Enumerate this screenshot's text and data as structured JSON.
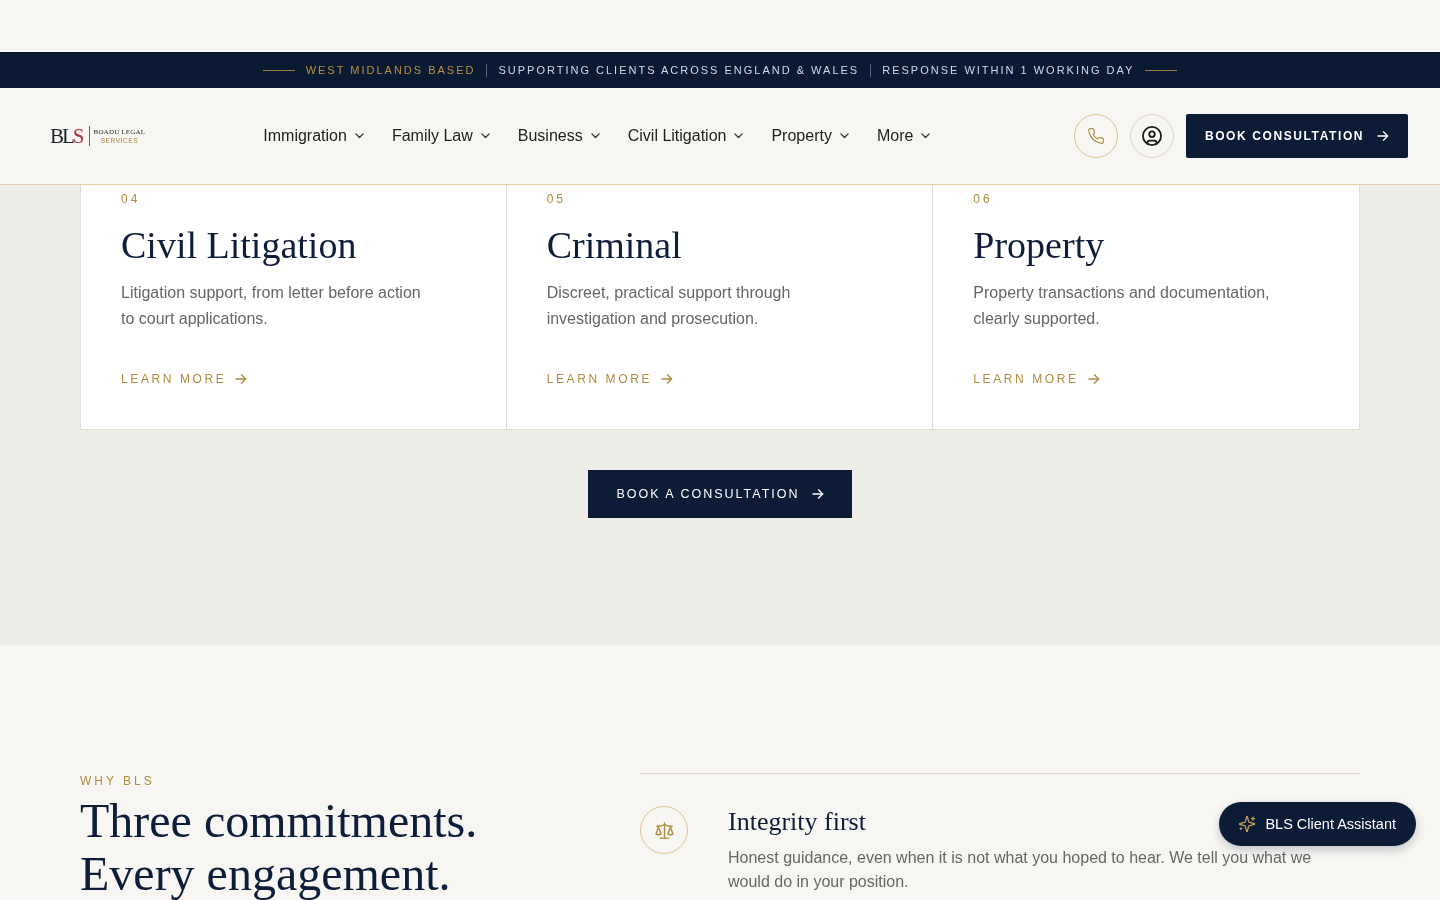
{
  "top_bar": {
    "items": [
      {
        "text": "WEST MIDLANDS BASED",
        "highlighted": true
      },
      {
        "text": "SUPPORTING CLIENTS ACROSS ENGLAND & WALES",
        "highlighted": false
      },
      {
        "text": "RESPONSE WITHIN 1 WORKING DAY",
        "highlighted": false
      }
    ]
  },
  "header": {
    "logo": {
      "monogram": "BLS",
      "name": "BOADU LEGAL",
      "tagline": "SERVICES"
    },
    "nav": [
      {
        "label": "Immigration"
      },
      {
        "label": "Family Law"
      },
      {
        "label": "Business"
      },
      {
        "label": "Civil Litigation"
      },
      {
        "label": "Property"
      },
      {
        "label": "More"
      }
    ],
    "cta": "BOOK CONSULTATION"
  },
  "services": {
    "cards": [
      {
        "number": "04",
        "title": "Civil Litigation",
        "description": "Litigation support, from letter before action to court applications.",
        "link": "LEARN MORE"
      },
      {
        "number": "05",
        "title": "Criminal",
        "description": "Discreet, practical support through investigation and prosecution.",
        "link": "LEARN MORE"
      },
      {
        "number": "06",
        "title": "Property",
        "description": "Property transactions and documentation, clearly supported.",
        "link": "LEARN MORE"
      }
    ],
    "cta": "BOOK A CONSULTATION"
  },
  "why": {
    "eyebrow": "WHY BLS",
    "heading": "Three commitments. Every engagement.",
    "commitments": [
      {
        "title": "Integrity first",
        "description": "Honest guidance, even when it is not what you hoped to hear. We tell you what we would do in your position."
      }
    ]
  },
  "assistant": {
    "label": "BLS Client Assistant"
  }
}
